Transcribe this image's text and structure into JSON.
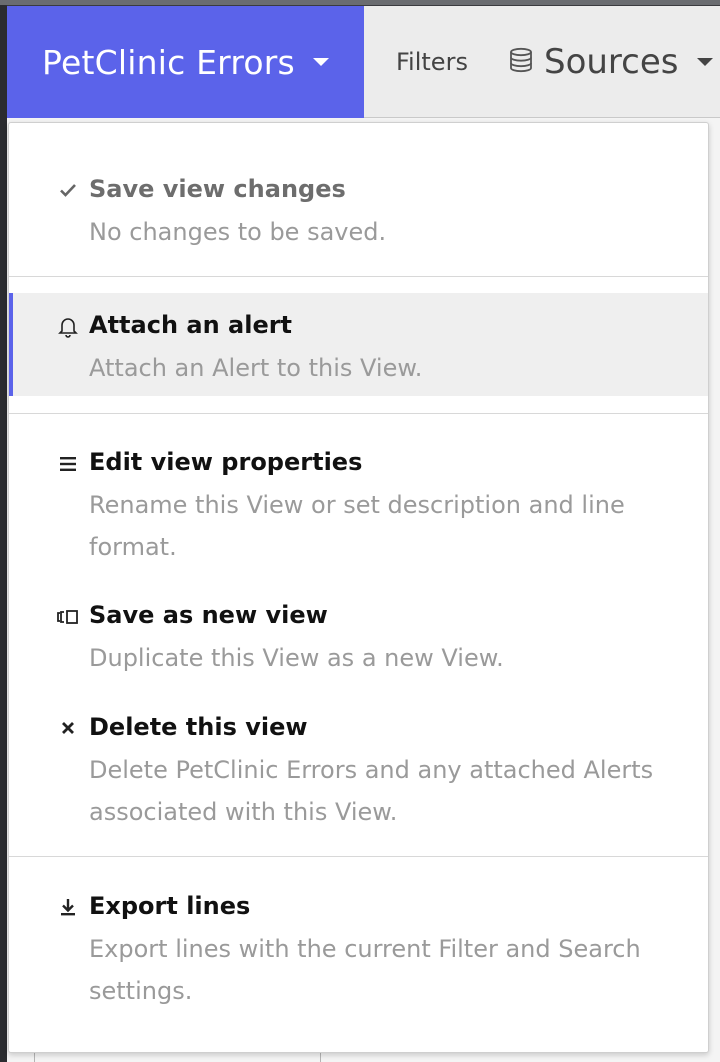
{
  "header": {
    "view_name": "PetClinic Errors",
    "filters_label": "Filters",
    "sources_label": "Sources"
  },
  "menu": {
    "items": [
      {
        "icon": "check-icon",
        "title": "Save view changes",
        "description": "No changes to be saved.",
        "disabled": true
      },
      {
        "icon": "bell-icon",
        "title": "Attach an alert",
        "description": "Attach an Alert to this View.",
        "highlighted": true
      },
      {
        "icon": "menu-lines-icon",
        "title": "Edit view properties",
        "description": "Rename this View or set description and line format."
      },
      {
        "icon": "duplicate-icon",
        "title": "Save as new view",
        "description": "Duplicate this View as a new View."
      },
      {
        "icon": "close-icon",
        "title": "Delete this view",
        "description": "Delete PetClinic Errors and any attached Alerts associated with this View."
      },
      {
        "icon": "download-icon",
        "title": "Export lines",
        "description": "Export lines with the current Filter and Search settings."
      }
    ]
  },
  "colors": {
    "accent": "#5b63ea",
    "hover_bg": "#efefef"
  }
}
